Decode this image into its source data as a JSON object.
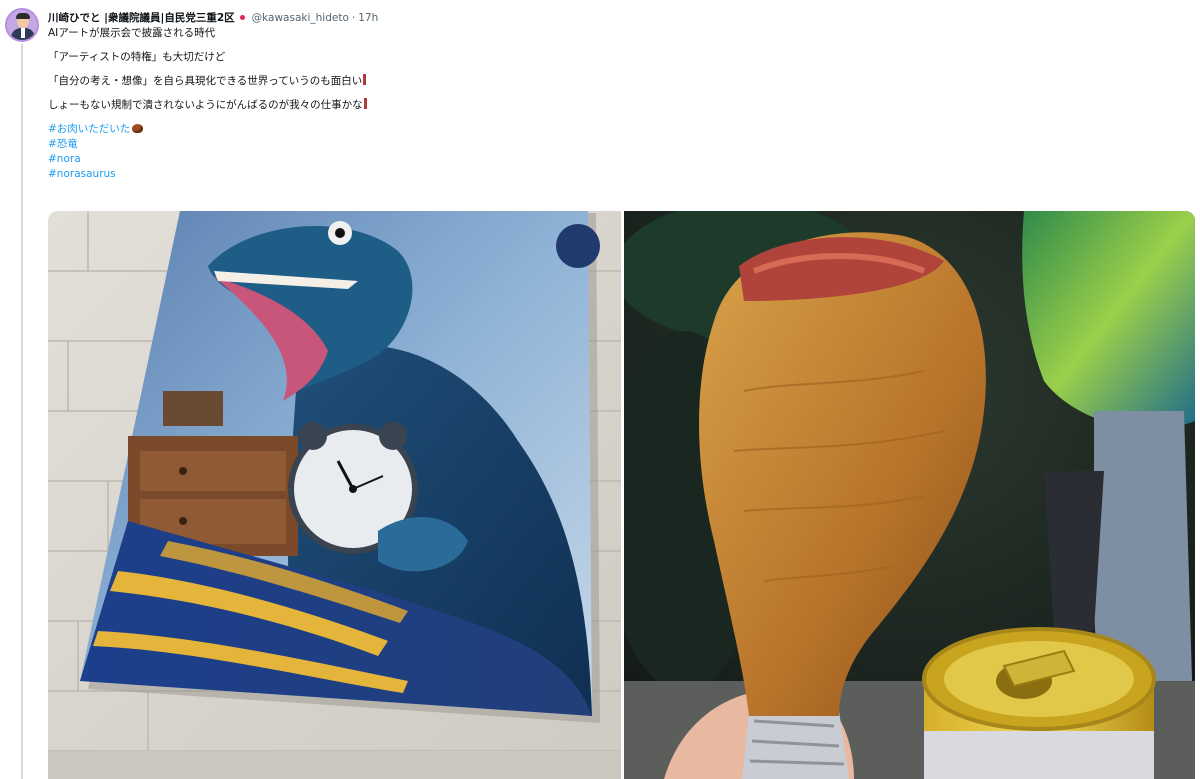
{
  "author": {
    "name": "川崎ひでと |衆議院議員|自民党三重2区",
    "handle": "@kawasaki_hideto",
    "separator": "·",
    "time": "17h"
  },
  "tweet": {
    "line1": "AIアートが展示会で披露される時代",
    "line2": "「アーティストの特権」も大切だけど",
    "line3": "「自分の考え・想像」を自ら具現化できる世界っていうのも面白い",
    "line4": "しょーもない規制で潰されないようにがんばるのが我々の仕事かな",
    "hashtags": [
      "#お肉いただいた",
      "#恐竜",
      "#nora",
      "#norasaurus"
    ]
  },
  "media": {
    "left_photo": "dinosaur-painting-photo",
    "right_photo": "turkey-leg-photo"
  },
  "icons": {
    "flag": "japan-flag-icon",
    "meat": "meat-emoji-icon",
    "mark": "red-mark-icon"
  },
  "colors": {
    "text": "#0f1419",
    "muted": "#536471",
    "hashtag": "#1d9bf0",
    "thread_line": "#cfd9de"
  }
}
